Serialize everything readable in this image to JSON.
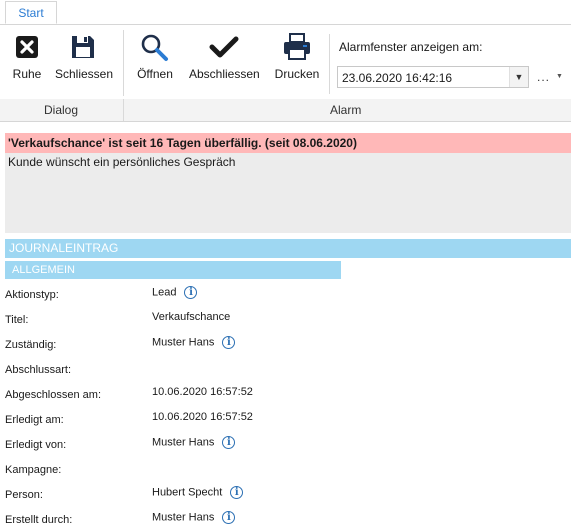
{
  "tabs": [
    {
      "label": "Start"
    }
  ],
  "ribbon": {
    "buttons": {
      "ruhe": {
        "label": "Ruhe",
        "icon": "close-x-icon"
      },
      "schliessen": {
        "label": "Schliessen",
        "icon": "save-icon"
      },
      "oeffnen": {
        "label": "Öffnen",
        "icon": "search-icon"
      },
      "abschliessen": {
        "label": "Abschliessen",
        "icon": "checkmark-icon"
      },
      "drucken": {
        "label": "Drucken",
        "icon": "printer-icon"
      }
    },
    "groups": {
      "dialog": "Dialog",
      "alarm": "Alarm"
    },
    "alarm_window_label": "Alarmfenster anzeigen am:",
    "alarm_datetime": "23.06.2020 16:42:16",
    "more_label": "..."
  },
  "alarm": {
    "header": "'Verkaufschance' ist seit 16 Tagen überfällig. (seit 08.06.2020)",
    "body": "Kunde wünscht ein persönliches Gespräch",
    "header_color": "#ffb8b8"
  },
  "journal": {
    "section_title": "JOURNALEINTRAG",
    "subsection_title": "ALLGEMEIN",
    "section_color": "#9ed7f2",
    "fields": [
      {
        "label": "Aktionstyp:",
        "value": "Lead",
        "info": true
      },
      {
        "label": "Titel:",
        "value": "Verkaufschance",
        "info": false
      },
      {
        "label": "Zuständig:",
        "value": "Muster Hans",
        "info": true
      },
      {
        "label": "Abschlussart:",
        "value": "",
        "info": false
      },
      {
        "label": "Abgeschlossen am:",
        "value": "10.06.2020 16:57:52",
        "info": false
      },
      {
        "label": "Erledigt am:",
        "value": "10.06.2020 16:57:52",
        "info": false
      },
      {
        "label": "Erledigt von:",
        "value": "Muster Hans",
        "info": true
      },
      {
        "label": "Kampagne:",
        "value": "",
        "info": false
      },
      {
        "label": "Person:",
        "value": "Hubert Specht",
        "info": true
      },
      {
        "label": "Erstellt durch:",
        "value": "Muster Hans",
        "info": true
      }
    ]
  }
}
